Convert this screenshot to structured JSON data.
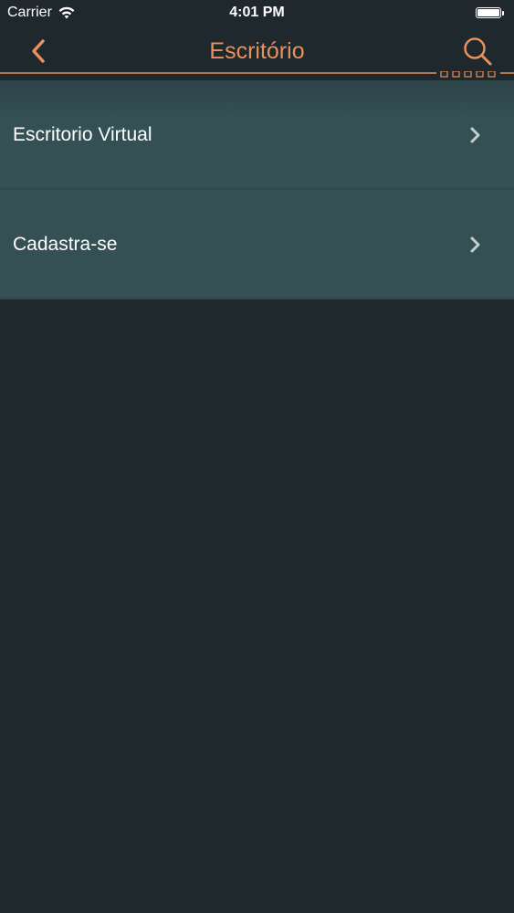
{
  "status_bar": {
    "carrier": "Carrier",
    "time": "4:01 PM",
    "wifi_icon": "wifi-icon",
    "battery_icon": "battery-icon"
  },
  "nav": {
    "title": "Escritório",
    "back_icon": "chevron-left-icon",
    "search_icon": "search-icon"
  },
  "menu": {
    "items": [
      {
        "label": "Escritorio Virtual",
        "icon": "chevron-right-icon"
      },
      {
        "label": "Cadastra-se",
        "icon": "chevron-right-icon"
      }
    ]
  },
  "colors": {
    "background": "#1e282d",
    "accent": "#e8915e",
    "row": "#345055",
    "text": "#ffffff"
  }
}
